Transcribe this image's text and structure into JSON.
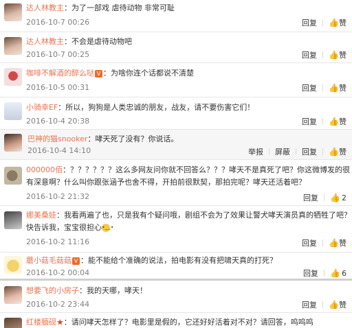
{
  "actions": {
    "reply": "回复",
    "like": "赞",
    "report": "举报",
    "block": "屏蔽"
  },
  "comments": [
    {
      "user": "达人林教主",
      "sep": "：",
      "text": "为了一部戏 虐待动物 非常可耻",
      "time": "2016-10-7 00:26",
      "like_count": ""
    },
    {
      "user": "达人林教主",
      "sep": "：",
      "text": "不会是虐待动物吧",
      "time": "2016-10-7 00:25",
      "like_count": ""
    },
    {
      "user": "咖啡不解酒的醉么哒",
      "sep": "：",
      "text": "为啥你连个话都说不清楚",
      "time": "2016-10-5 00:31",
      "like_count": ""
    },
    {
      "user": "小骑幸EF",
      "sep": "：",
      "text": "所以，狗狗是人类忠诚的朋友，战友，请不要伤害它们！",
      "time": "2016-10-4 20:38",
      "like_count": ""
    },
    {
      "user": "巴神的猫snooker",
      "sep": "：",
      "text": "哮天死了没有？你说话。",
      "time": "2016-10-4 14:10",
      "like_count": ""
    },
    {
      "user": "000000佰",
      "sep": "：",
      "text": "？？？？？？这么多网友问你就不回答么？？？哮天不是真死了吧？你这微博发的很",
      "text2": "有深意啊？什么叫你跟张涵予也舍不得，开拍前很默契，那拍完呢？哮天还活着吧？",
      "time": "2016-10-2 21:32",
      "like_count": "2"
    },
    {
      "user": "娜美桑娃",
      "sep": "：",
      "text": "我看两遍了也，只是我有个疑问哦，剧组不会为了效果让警犬哮天演员真的牺牲了吧？",
      "text2": "快告诉我，宝宝很担心",
      "time": "2016-10-2 11:16",
      "like_count": ""
    },
    {
      "user": "蘑小菇毛菇菇",
      "sep": "：",
      "text": "能不能给个准确的说法，拍电影有没有把啸天真的打死？",
      "time": "2016-10-2 00:04",
      "like_count": "6"
    },
    {
      "user": "想要飞的小房子",
      "sep": "：",
      "text": "我的天哪，哮天！",
      "time": "2016-10-2 23:44",
      "like_count": ""
    },
    {
      "user": "红楼腼砚",
      "sep": "：",
      "text": "请问哮天怎样了？电影里是假的，它还好好活着对不对？请回答，呜呜呜",
      "time": "",
      "like_count": ""
    }
  ],
  "colors": {
    "username": "#eb7350",
    "badge": "#ee6a2a",
    "meta": "#808080"
  }
}
